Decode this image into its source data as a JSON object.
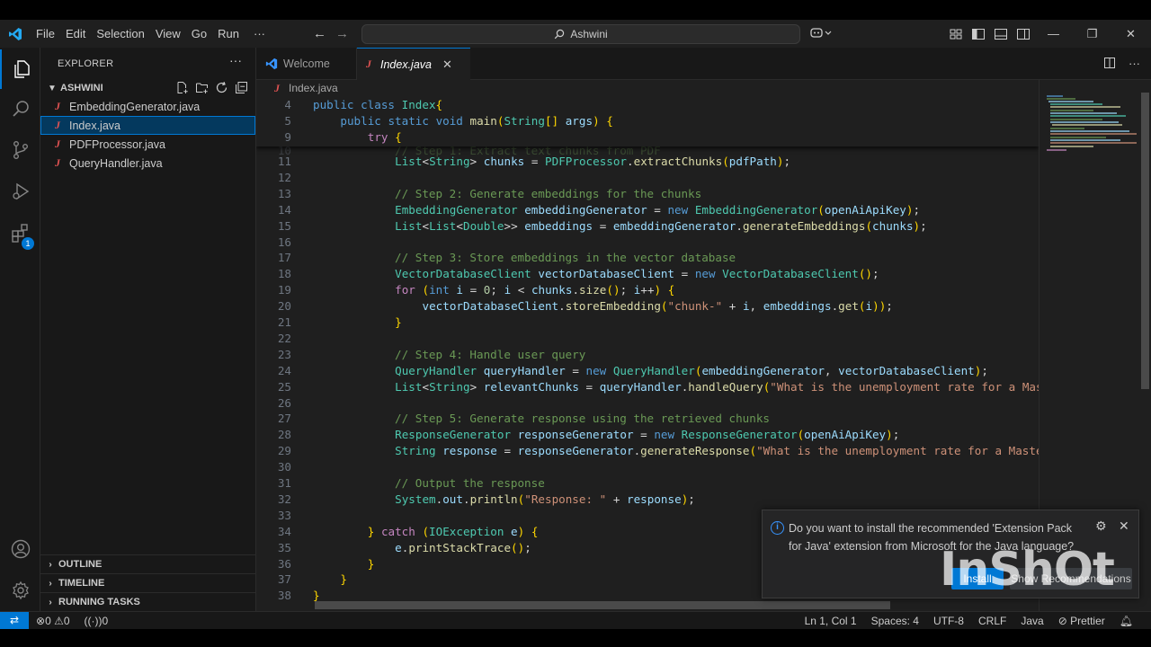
{
  "menu": [
    "File",
    "Edit",
    "Selection",
    "View",
    "Go",
    "Run",
    "···"
  ],
  "search": {
    "text": "Ashwini"
  },
  "explorer": {
    "title": "EXPLORER",
    "more": "···",
    "folder": "ASHWINI",
    "files": [
      "EmbeddingGenerator.java",
      "Index.java",
      "PDFProcessor.java",
      "QueryHandler.java"
    ],
    "selected_index": 1,
    "sections": [
      "OUTLINE",
      "TIMELINE",
      "RUNNING TASKS"
    ]
  },
  "activity": {
    "extensions_badge": "1"
  },
  "tabs": [
    {
      "label": "Welcome"
    },
    {
      "label": "Index.java"
    }
  ],
  "breadcrumb": "Index.java",
  "sticky_lines": [
    {
      "n": "4",
      "t": "public class Index{"
    },
    {
      "n": "5",
      "t": "    public static void main(String[] args) {"
    },
    {
      "n": "9",
      "t": "        try {"
    }
  ],
  "code_lines": [
    {
      "n": "11",
      "t": "            List<String> chunks = PDFProcessor.extractChunks(pdfPath);"
    },
    {
      "n": "12",
      "t": ""
    },
    {
      "n": "13",
      "t": "            // Step 2: Generate embeddings for the chunks"
    },
    {
      "n": "14",
      "t": "            EmbeddingGenerator embeddingGenerator = new EmbeddingGenerator(openAiApiKey);"
    },
    {
      "n": "15",
      "t": "            List<List<Double>> embeddings = embeddingGenerator.generateEmbeddings(chunks);"
    },
    {
      "n": "16",
      "t": ""
    },
    {
      "n": "17",
      "t": "            // Step 3: Store embeddings in the vector database"
    },
    {
      "n": "18",
      "t": "            VectorDatabaseClient vectorDatabaseClient = new VectorDatabaseClient();"
    },
    {
      "n": "19",
      "t": "            for (int i = 0; i < chunks.size(); i++) {"
    },
    {
      "n": "20",
      "t": "                vectorDatabaseClient.storeEmbedding(\"chunk-\" + i, embeddings.get(i));"
    },
    {
      "n": "21",
      "t": "            }"
    },
    {
      "n": "22",
      "t": ""
    },
    {
      "n": "23",
      "t": "            // Step 4: Handle user query"
    },
    {
      "n": "24",
      "t": "            QueryHandler queryHandler = new QueryHandler(embeddingGenerator, vectorDatabaseClient);"
    },
    {
      "n": "25",
      "t": "            List<String> relevantChunks = queryHandler.handleQuery(\"What is the unemployment rate for a Master's"
    },
    {
      "n": "26",
      "t": ""
    },
    {
      "n": "27",
      "t": "            // Step 5: Generate response using the retrieved chunks"
    },
    {
      "n": "28",
      "t": "            ResponseGenerator responseGenerator = new ResponseGenerator(openAiApiKey);"
    },
    {
      "n": "29",
      "t": "            String response = responseGenerator.generateResponse(\"What is the unemployment rate for a Master's d"
    },
    {
      "n": "30",
      "t": ""
    },
    {
      "n": "31",
      "t": "            // Output the response"
    },
    {
      "n": "32",
      "t": "            System.out.println(\"Response: \" + response);"
    },
    {
      "n": "33",
      "t": ""
    },
    {
      "n": "34",
      "t": "        } catch (IOException e) {"
    },
    {
      "n": "35",
      "t": "            e.printStackTrace();"
    },
    {
      "n": "36",
      "t": "        }"
    },
    {
      "n": "37",
      "t": "    }"
    },
    {
      "n": "38",
      "t": "}"
    }
  ],
  "notification": {
    "message": "Do you want to install the recommended 'Extension Pack for Java' extension from Microsoft for the Java language?",
    "install": "Install",
    "recommendations": "Show Recommendations",
    "watermark": "InShOt"
  },
  "status": {
    "problems": "0",
    "warnings": "0",
    "ports": "0",
    "position": "Ln 1, Col 1",
    "spaces": "Spaces: 4",
    "encoding": "UTF-8",
    "eol": "CRLF",
    "language": "Java",
    "prettier": "Prettier"
  },
  "colors": {
    "accent": "#0078d4",
    "java_icon": "#e05252"
  }
}
